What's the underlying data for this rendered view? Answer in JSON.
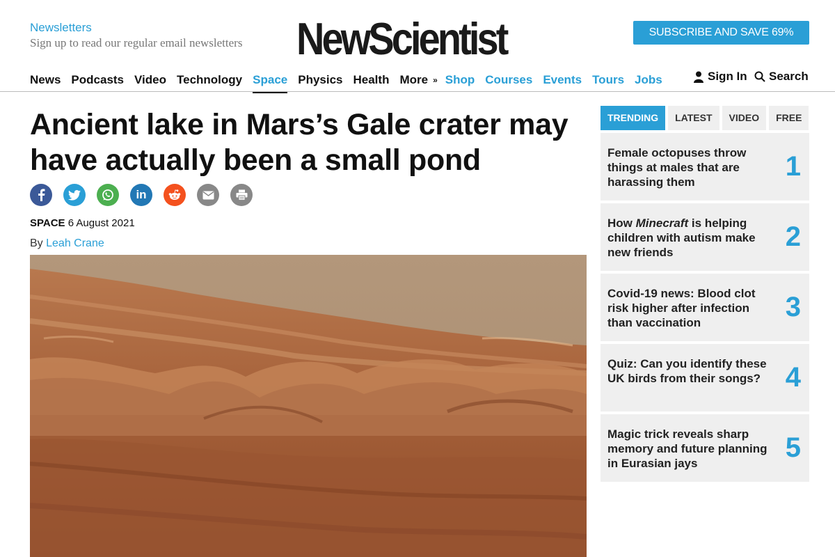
{
  "header": {
    "newsletters_label": "Newsletters",
    "newsletters_sub": "Sign up to read our regular email newsletters",
    "logo_text": "NewScientist",
    "subscribe_label": "SUBSCRIBE AND SAVE 69%"
  },
  "nav": {
    "items": [
      "News",
      "Podcasts",
      "Video",
      "Technology",
      "Space",
      "Physics",
      "Health",
      "More",
      "Shop",
      "Courses",
      "Events",
      "Tours",
      "Jobs"
    ],
    "active": "Space",
    "sign_in": "Sign In",
    "search": "Search"
  },
  "article": {
    "headline": "Ancient lake in Mars’s Gale crater may have actually been a small pond",
    "section": "SPACE",
    "date": "6 August 2021",
    "by_prefix": "By",
    "author": "Leah Crane",
    "share_icons": [
      "facebook-icon",
      "twitter-icon",
      "whatsapp-icon",
      "linkedin-icon",
      "reddit-icon",
      "email-icon",
      "print-icon"
    ]
  },
  "sidebar": {
    "tabs": [
      "TRENDING",
      "LATEST",
      "VIDEO",
      "FREE"
    ],
    "active_tab": "TRENDING",
    "trending": [
      {
        "title": "Female octopuses throw things at males that are harassing them",
        "num": "1"
      },
      {
        "title_pre": "How ",
        "title_em": "Minecraft",
        "title_post": " is helping children with autism make new friends",
        "num": "2"
      },
      {
        "title": "Covid-19 news: Blood clot risk higher after infection than vaccination",
        "num": "3"
      },
      {
        "title": "Quiz: Can you identify these UK birds from their songs?",
        "num": "4"
      },
      {
        "title": "Magic trick reveals sharp memory and future planning in Eurasian jays",
        "num": "5"
      }
    ]
  },
  "colors": {
    "accent": "#2a9fd6",
    "facebook": "#3b5998",
    "twitter": "#2a9fd6",
    "whatsapp": "#4caf50",
    "linkedin": "#2278b5",
    "reddit": "#f4511e",
    "email": "#888888",
    "print": "#888888"
  }
}
